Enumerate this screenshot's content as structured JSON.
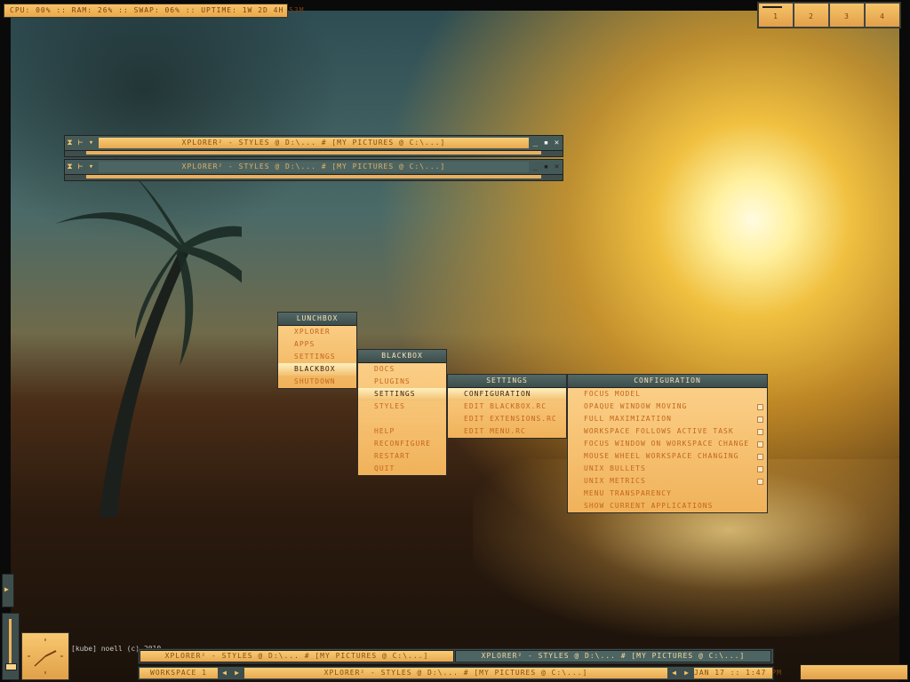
{
  "sysinfo": {
    "text": "CPU: 00% :: RAM: 26% :: SWAP: 06% :: UPTIME: 1W 2D 4H 53M"
  },
  "workspaces": [
    "1",
    "2",
    "3",
    "4"
  ],
  "windows": [
    {
      "title": "XPLORER² - STYLES @ D:\\... # [MY PICTURES @ C:\\...]",
      "state": "focused"
    },
    {
      "title": "XPLORER² - STYLES @ D:\\... # [MY PICTURES @ C:\\...]",
      "state": "unfocused"
    }
  ],
  "menus": {
    "lunchbox": {
      "title": "LUNCHBOX",
      "items": [
        "XPLORER",
        "APPS",
        "SETTINGS",
        "BLACKBOX",
        "SHUTDOWN"
      ],
      "selected": "BLACKBOX"
    },
    "blackbox": {
      "title": "BLACKBOX",
      "items": [
        "DOCS",
        "PLUGINS",
        "SETTINGS",
        "STYLES",
        "",
        "HELP",
        "RECONFIGURE",
        "RESTART",
        "QUIT"
      ],
      "selected": "SETTINGS"
    },
    "settings": {
      "title": "SETTINGS",
      "items": [
        "CONFIGURATION",
        "EDIT BLACKBOX.RC",
        "EDIT EXTENSIONS.RC",
        "EDIT MENU.RC"
      ],
      "selected": "CONFIGURATION"
    },
    "configuration": {
      "title": "CONFIGURATION",
      "items": [
        "FOCUS MODEL",
        "OPAQUE WINDOW MOVING",
        "FULL MAXIMIZATION",
        "WORKSPACE FOLLOWS ACTIVE TASK",
        "FOCUS WINDOW ON WORKSPACE CHANGE",
        "MOUSE WHEEL WORKSPACE CHANGING",
        "UNIX BULLETS",
        "UNIX METRICS",
        "MENU TRANSPARENCY",
        "SHOW CURRENT APPLICATIONS"
      ]
    }
  },
  "credit": "[kube] noell (c) 2010",
  "taskbar": {
    "tasks": [
      "XPLORER² - STYLES @ D:\\... # [MY PICTURES @ C:\\...]",
      "XPLORER² - STYLES @ D:\\... # [MY PICTURES @ C:\\...]"
    ],
    "workspace_label": "WORKSPACE 1",
    "current_window": "XPLORER² - STYLES @ D:\\... # [MY PICTURES @ C:\\...]",
    "clock_text": "JAN 17 :: 1:47 PM"
  },
  "colors": {
    "accent": "#f0b25a",
    "text": "#c4661c",
    "dark": "#3e4e4c"
  }
}
